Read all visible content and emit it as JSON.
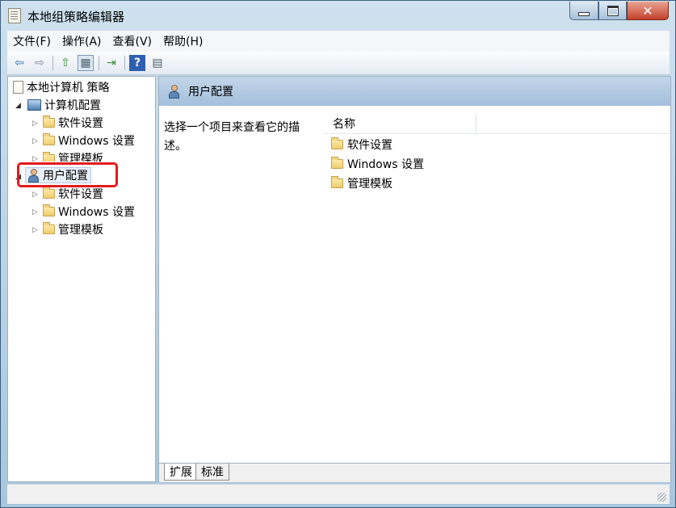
{
  "window": {
    "title": "本地组策略编辑器"
  },
  "menu": [
    "文件(F)",
    "操作(A)",
    "查看(V)",
    "帮助(H)"
  ],
  "toolbar": {
    "icons": [
      "back-arrow-icon",
      "forward-arrow-icon",
      "up-folder-icon",
      "show-hide-tree-icon",
      "export-list-icon",
      "help-icon",
      "properties-icon"
    ],
    "glyphs": {
      "back": "⇦",
      "forward": "⇨",
      "up": "⇧",
      "tree": "▦",
      "export": "⇥",
      "help": "?",
      "props": "▤"
    }
  },
  "tree": {
    "root": "本地计算机 策略",
    "computer": {
      "label": "计算机配置",
      "children": [
        "软件设置",
        "Windows 设置",
        "管理模板"
      ]
    },
    "user": {
      "label": "用户配置",
      "children": [
        "软件设置",
        "Windows 设置",
        "管理模板"
      ]
    },
    "arrow_closed": "▷",
    "arrow_open": "◢"
  },
  "right": {
    "header": "用户配置",
    "description": "选择一个项目来查看它的描述。",
    "column_name": "名称",
    "items": [
      "软件设置",
      "Windows 设置",
      "管理模板"
    ]
  },
  "tabs": [
    "扩展",
    "标准"
  ],
  "colors": {
    "highlight": "#e31b1b",
    "header_bg": "#a4bfdc"
  }
}
